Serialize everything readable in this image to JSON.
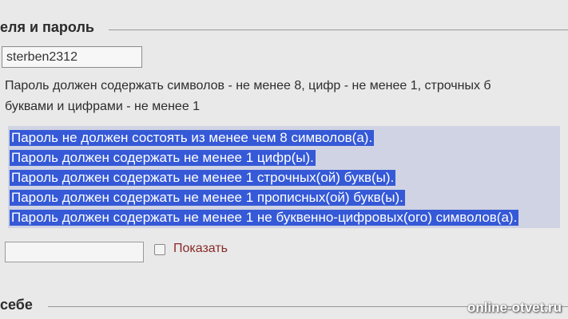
{
  "fieldset": {
    "legend": "еля и пароль"
  },
  "username": {
    "value": "sterben2312"
  },
  "hint": {
    "line1": "Пароль должен содержать символов - не менее 8, цифр - не менее 1, строчных б",
    "line2": "буквами и цифрами - не менее 1"
  },
  "errors": [
    "Пароль не должен состоять из менее чем 8 символов(а).",
    "Пароль должен содержать не менее 1 цифр(ы).",
    "Пароль должен содержать не менее 1 строчных(ой) букв(ы).",
    "Пароль должен содержать не менее 1 прописных(ой) букв(ы).",
    "Пароль должен содержать не менее 1 не буквенно-цифровых(ого) символов(а)."
  ],
  "password": {
    "value": ""
  },
  "show_password": {
    "label": "Показать",
    "checked": false
  },
  "section2": {
    "legend": "себе"
  },
  "watermark": "online-otvet.ru"
}
